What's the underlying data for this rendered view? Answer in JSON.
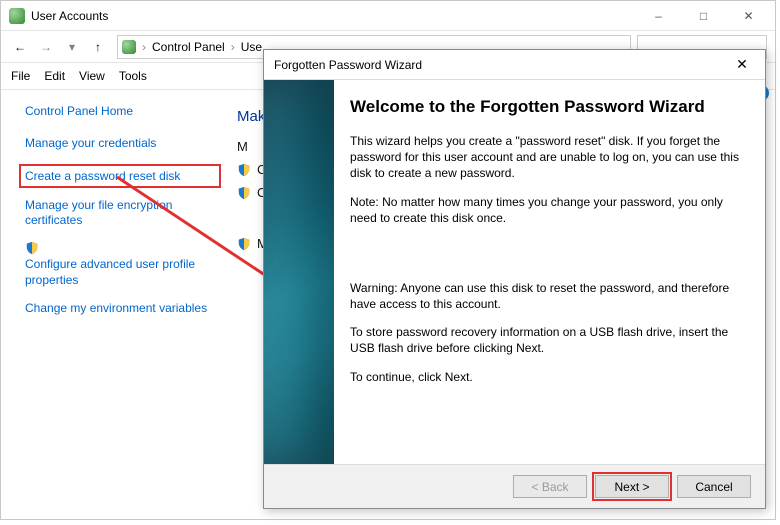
{
  "window": {
    "title": "User Accounts",
    "controls": {
      "minimize": "–",
      "maximize": "□",
      "close": "✕"
    }
  },
  "nav": {
    "back": "←",
    "forward": "→",
    "up": "↑",
    "dropdown": "▾",
    "breadcrumb": [
      "Control Panel",
      "Use…"
    ]
  },
  "menu": {
    "file": "File",
    "edit": "Edit",
    "view": "View",
    "tools": "Tools"
  },
  "side": {
    "home": "Control Panel Home",
    "items": [
      {
        "label": "Manage your credentials",
        "shield": false
      },
      {
        "label": "Create a password reset disk",
        "shield": false,
        "highlighted": true
      },
      {
        "label": "Manage your file encryption certificates",
        "shield": false
      },
      {
        "label": "Configure advanced user profile properties",
        "shield": true
      },
      {
        "label": "Change my environment variables",
        "shield": false
      }
    ]
  },
  "main": {
    "heading": "Make",
    "options": [
      {
        "label": "M",
        "shield": false
      },
      {
        "label": "Ch",
        "shield": true
      },
      {
        "label": "Ch",
        "shield": true
      },
      {
        "label": "M",
        "shield": true
      }
    ]
  },
  "wizard": {
    "title": "Forgotten Password Wizard",
    "close": "✕",
    "heading": "Welcome to the Forgotten Password Wizard",
    "p1": "This wizard helps you create a \"password reset\" disk. If you forget the password for this user account and are unable to log on, you can use this disk to create a new password.",
    "p2": "Note: No matter how many times you change your password, you only need to create this disk once.",
    "p3": "Warning: Anyone can use this disk to reset the password, and therefore have access to this account.",
    "p4": "To store password recovery information on a USB flash drive, insert the USB flash drive before clicking Next.",
    "p5": "To continue, click Next.",
    "buttons": {
      "back": "< Back",
      "next": "Next >",
      "cancel": "Cancel"
    }
  },
  "help": "?"
}
